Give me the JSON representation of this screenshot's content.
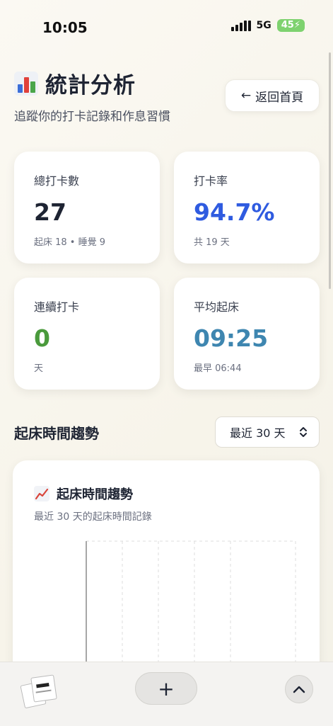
{
  "status_bar": {
    "time": "10:05",
    "network": "5G",
    "battery": "45"
  },
  "header": {
    "title": "統計分析",
    "subtitle": "追蹤你的打卡記錄和作息習慣",
    "back_arrow": "←",
    "back_label": "返回首頁"
  },
  "stats": [
    {
      "label": "總打卡數",
      "value": "27",
      "sub": "起床 18 • 睡覺 9",
      "color": "#1e2433"
    },
    {
      "label": "打卡率",
      "value": "94.7%",
      "sub": "共 19 天",
      "color": "#2f5be0"
    },
    {
      "label": "連續打卡",
      "value": "0",
      "sub": "天",
      "color": "#4a9a3c"
    },
    {
      "label": "平均起床",
      "value": "09:25",
      "sub": "最早 06:44",
      "color": "#3e86b0"
    }
  ],
  "trend": {
    "section_title": "起床時間趨勢",
    "range_value": "最近 30 天",
    "card_title": "起床時間趨勢",
    "card_subtitle": "最近 30 天的起床時間記錄"
  },
  "icons": {
    "page": "bar-chart-icon",
    "chart": "chart-increasing-icon",
    "select": "chevron-up-down-icon",
    "add": "plus-icon",
    "up": "chevron-up-icon"
  },
  "bottom_bar": {
    "add_label": "+"
  }
}
